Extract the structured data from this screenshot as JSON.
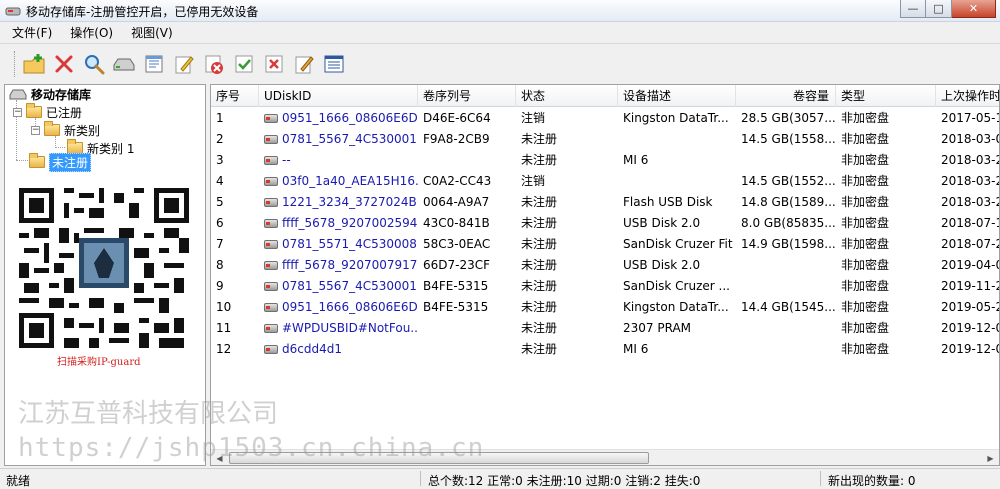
{
  "window": {
    "title": "移动存储库-注册管控开启，已停用无效设备",
    "minimize_label": "—",
    "maximize_label": "□",
    "close_label": "✕"
  },
  "menu": [
    "文件(F)",
    "操作(O)",
    "视图(V)"
  ],
  "toolbar": {
    "icons": [
      "open-folder-add-icon",
      "delete-x-icon",
      "search-icon",
      "disk-drive-icon",
      "properties-icon",
      "edit-icon",
      "disable-icon",
      "approve-icon",
      "reject-icon",
      "edit-note-icon",
      "list-view-icon"
    ]
  },
  "tree": {
    "root": "移动存储库",
    "registered": "已注册",
    "category": "新类别",
    "category1": "新类别 1",
    "unregistered": "未注册"
  },
  "qr_caption": "扫描采购IP-guard",
  "table": {
    "columns": [
      "序号",
      "UDiskID",
      "卷序列号",
      "状态",
      "设备描述",
      "卷容量",
      "类型",
      "上次操作时"
    ],
    "rows": [
      [
        "1",
        "0951_1666_08606E6D...",
        "D46E-6C64",
        "注销",
        "Kingston DataTr...",
        "28.5 GB(3057...",
        "非加密盘",
        "2017-05-1"
      ],
      [
        "2",
        "0781_5567_4C530001...",
        "F9A8-2CB9",
        "未注册",
        "",
        "14.5 GB(1558...",
        "非加密盘",
        "2018-03-0"
      ],
      [
        "3",
        "--",
        "",
        "未注册",
        "MI 6",
        "",
        "非加密盘",
        "2018-03-2"
      ],
      [
        "4",
        "03f0_1a40_AEA15H16...",
        "C0A2-CC43",
        "注销",
        "",
        "14.5 GB(1552...",
        "非加密盘",
        "2018-03-2"
      ],
      [
        "5",
        "1221_3234_3727024B...",
        "0064-A9A7",
        "未注册",
        "Flash USB Disk",
        "14.8 GB(1589...",
        "非加密盘",
        "2018-03-2"
      ],
      [
        "6",
        "ffff_5678_9207002594...",
        "43C0-841B",
        "未注册",
        "USB Disk 2.0",
        "8.0 GB(85835...",
        "非加密盘",
        "2018-07-1"
      ],
      [
        "7",
        "0781_5571_4C530008...",
        "58C3-0EAC",
        "未注册",
        "SanDisk Cruzer Fit",
        "14.9 GB(1598...",
        "非加密盘",
        "2018-07-2"
      ],
      [
        "8",
        "ffff_5678_9207007917...",
        "66D7-23CF",
        "未注册",
        "USB Disk 2.0",
        "",
        "非加密盘",
        "2019-04-0"
      ],
      [
        "9",
        "0781_5567_4C530001...",
        "B4FE-5315",
        "未注册",
        "SanDisk Cruzer ...",
        "",
        "非加密盘",
        "2019-11-2"
      ],
      [
        "10",
        "0951_1666_08606E6D...",
        "B4FE-5315",
        "未注册",
        "Kingston DataTr...",
        "14.4 GB(1545...",
        "非加密盘",
        "2019-05-2"
      ],
      [
        "11",
        "#WPDUSBID#NotFou...",
        "",
        "未注册",
        "2307 PRAM",
        "",
        "非加密盘",
        "2019-12-0"
      ],
      [
        "12",
        "d6cdd4d1",
        "",
        "未注册",
        "MI 6",
        "",
        "非加密盘",
        "2019-12-0"
      ]
    ]
  },
  "status": {
    "ready": "就绪",
    "counts": "总个数:12  正常:0  未注册:10  过期:0  注销:2  挂失:0",
    "new_count": "新出现的数量:  0"
  },
  "watermark": {
    "line1": "江苏互普科技有限公司",
    "line2": "https://jshp1503.cn.china.cn"
  }
}
